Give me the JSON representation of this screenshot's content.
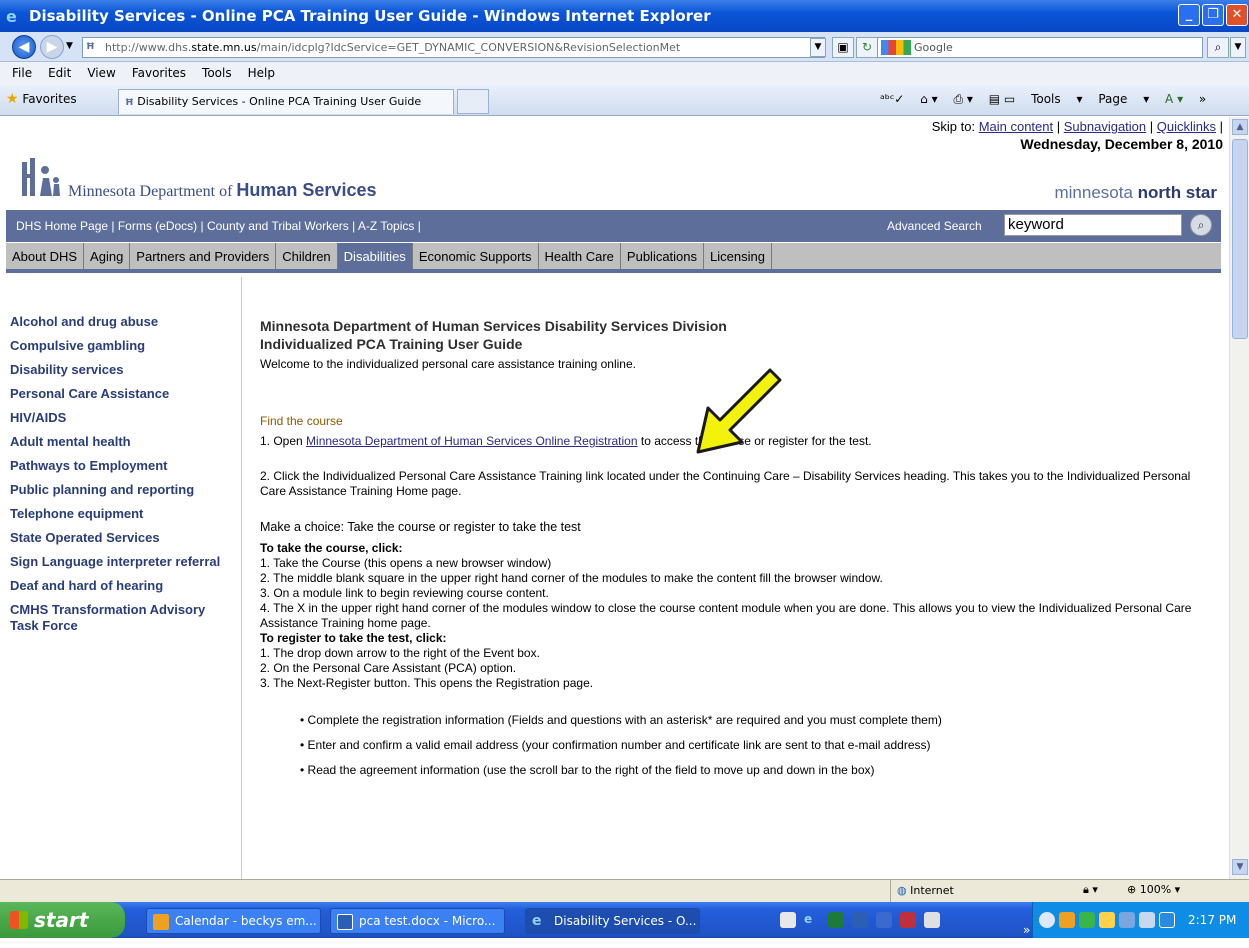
{
  "window": {
    "title": "Disability Services - Online PCA Training User Guide - Windows Internet Explorer"
  },
  "toolbar": {
    "address_prefix": "http://www.dhs.",
    "address_domain": "state.mn.us",
    "address_rest": "/main/idcplg?IdcService=GET_DYNAMIC_CONVERSION&RevisionSelectionMet",
    "search_placeholder": "Google"
  },
  "menu": [
    "File",
    "Edit",
    "View",
    "Favorites",
    "Tools",
    "Help"
  ],
  "favorites": {
    "label": "Favorites",
    "tab_title": "Disability Services - Online PCA Training User Guide",
    "cmd_tools": "Tools",
    "cmd_page": "Page"
  },
  "site": {
    "skip_prefix": "Skip to:",
    "skip_links": [
      "Main content",
      "Subnavigation",
      "Quicklinks"
    ],
    "date": "Wednesday, December 8, 2010",
    "agency_prefix": "Minnesota Department of",
    "agency_bold": "Human Services",
    "northstar_a": "minnesota",
    "northstar_b": "north star",
    "util_links": "DHS Home Page | Forms (eDocs) | County and Tribal Workers | A-Z Topics |",
    "advanced_search": "Advanced Search",
    "search_value": "keyword",
    "nav": [
      "About DHS",
      "Aging",
      "Partners and Providers",
      "Children",
      "Disabilities",
      "Economic Supports",
      "Health Care",
      "Publications",
      "Licensing"
    ],
    "active_nav": "Disabilities"
  },
  "leftnav": [
    "Alcohol and drug abuse",
    "Compulsive gambling",
    "Disability services",
    "Personal Care Assistance",
    "HIV/AIDS",
    "Adult mental health",
    "Pathways to Employment",
    "Public planning and reporting",
    "Telephone equipment",
    "State Operated Services",
    "Sign Language interpreter referral",
    "Deaf and hard of hearing",
    "CMHS Transformation Advisory Task Force"
  ],
  "content": {
    "heading1": "Minnesota Department of Human Services Disability Services Division",
    "heading2": "Individualized PCA Training User Guide",
    "welcome": "Welcome to the individualized personal care assistance training online.",
    "find_title": "Find the course",
    "step1_pre": "1. Open ",
    "step1_link": "Minnesota Department of Human Services Online Registration",
    "step1_post": " to access the course or register for the test.",
    "step2": "2. Click the Individualized Personal Care Assistance Training link located under the Continuing Care – Disability Services heading. This takes you to the Individualized Personal Care Assistance Training Home page.",
    "choice_title": "Make a choice: Take the course or register to take the test",
    "take_title": "To take the course, click:",
    "take_steps": [
      "1. Take the Course (this opens a new browser window)",
      "2. The middle blank square in the upper right hand corner of the modules to make the content fill the browser window.",
      "3. On a module link to begin reviewing course content.",
      "4. The X in the upper right hand corner of the modules window to close the course content module when you are done. This allows you to view the Individualized Personal Care Assistance Training home page."
    ],
    "register_title": "To register to take the test, click:",
    "register_steps": [
      "1. The drop down arrow to the right of the Event box.",
      "2. On the Personal Care Assistant (PCA) option.",
      "3. The Next-Register button. This opens the Registration page."
    ],
    "bullets": [
      "• Complete the registration information (Fields and questions with an asterisk* are required and you must complete them)",
      "• Enter and confirm a valid email address (your confirmation number and certificate link are sent to that e-mail address)",
      "• Read the agreement information (use the scroll bar to the right of the field to move up and down in the box)"
    ]
  },
  "status": {
    "zone": "Internet",
    "zoom": "100%"
  },
  "taskbar": {
    "start": "start",
    "tasks": [
      "Calendar - beckys em...",
      "pca test.docx - Micro...",
      "Disability Services - O..."
    ],
    "clock": "2:17 PM"
  },
  "colors": {
    "arrow": "#f3f20a",
    "nav_bar": "#5d6e9a",
    "xp_blue": "#245edb"
  }
}
